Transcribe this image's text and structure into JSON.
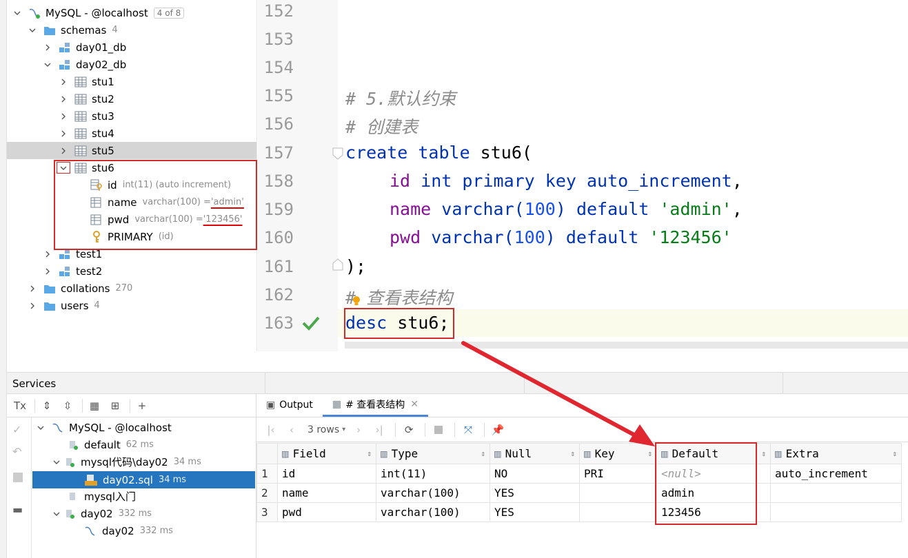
{
  "db_tree": {
    "connection": {
      "label": "MySQL - @localhost",
      "badge": "4 of 8"
    },
    "schemas": {
      "label": "schemas",
      "count": "4"
    },
    "day01": "day01_db",
    "day02": "day02_db",
    "tables": [
      "stu1",
      "stu2",
      "stu3",
      "stu4",
      "stu5",
      "stu6"
    ],
    "columns": [
      {
        "name": "id",
        "type_prefix": "int(11) (auto increment)",
        "default": ""
      },
      {
        "name": "name",
        "type_prefix": "varchar(100) = ",
        "default": "'admin'"
      },
      {
        "name": "pwd",
        "type_prefix": "varchar(100) = ",
        "default": "'123456'"
      },
      {
        "name": "PRIMARY",
        "type_prefix": "(id)",
        "default": ""
      }
    ],
    "test1": "test1",
    "test2": "test2",
    "collations": {
      "label": "collations",
      "count": "270"
    },
    "users": {
      "label": "users",
      "count": "4"
    }
  },
  "editor": {
    "lines": [
      "152",
      "153",
      "154",
      "155",
      "156",
      "157",
      "158",
      "159",
      "160",
      "161",
      "162",
      "163"
    ],
    "comment_155": "# 5.默认约束",
    "comment_156": "# 创建表",
    "create_kw": "create table",
    "create_name": " stu6(",
    "l158_field": "id",
    "l158_rest": " int primary key auto_increment",
    "l158_end": ",",
    "l159_field": "name",
    "l159_type": " varchar(",
    "l159_num": "100",
    "l159_def": ") default ",
    "l159_str": "'admin'",
    "l159_end": ",",
    "l160_field": "pwd",
    "l160_type": " varchar(",
    "l160_num": "100",
    "l160_def": ") default ",
    "l160_str": "'123456'",
    "l161": ");",
    "comment_162_hash": "#",
    "comment_162_text": " 查看表结构",
    "desc_kw": "desc",
    "desc_name": " stu6",
    "desc_end": ";"
  },
  "services": {
    "title": "Services",
    "tx": "Tx",
    "tree": [
      {
        "label": "MySQL - @localhost",
        "time": ""
      },
      {
        "label": "default",
        "time": "62 ms"
      },
      {
        "label": "mysql代码\\day02",
        "time": "34 ms"
      },
      {
        "label": "day02.sql",
        "time": "34 ms"
      },
      {
        "label": "mysql入门",
        "time": ""
      },
      {
        "label": "day02",
        "time": "332 ms"
      },
      {
        "label": "day02",
        "time": "332 ms"
      }
    ]
  },
  "results": {
    "tabs": {
      "output": "Output",
      "query": "# 查看表结构"
    },
    "rows_selector": "3 rows",
    "columns": [
      "Field",
      "Type",
      "Null",
      "Key",
      "Default",
      "Extra"
    ],
    "rows": [
      {
        "n": "1",
        "Field": "id",
        "Type": "int(11)",
        "Null": "NO",
        "Key": "PRI",
        "Default": "<null>",
        "Extra": "auto_increment"
      },
      {
        "n": "2",
        "Field": "name",
        "Type": "varchar(100)",
        "Null": "YES",
        "Key": "",
        "Default": "admin",
        "Extra": ""
      },
      {
        "n": "3",
        "Field": "pwd",
        "Type": "varchar(100)",
        "Null": "YES",
        "Key": "",
        "Default": "123456",
        "Extra": ""
      }
    ]
  },
  "colors": {
    "annotation_red": "#d02a2a",
    "selection_blue": "#2675bf",
    "keyword": "#0033b3",
    "string": "#067d17"
  }
}
